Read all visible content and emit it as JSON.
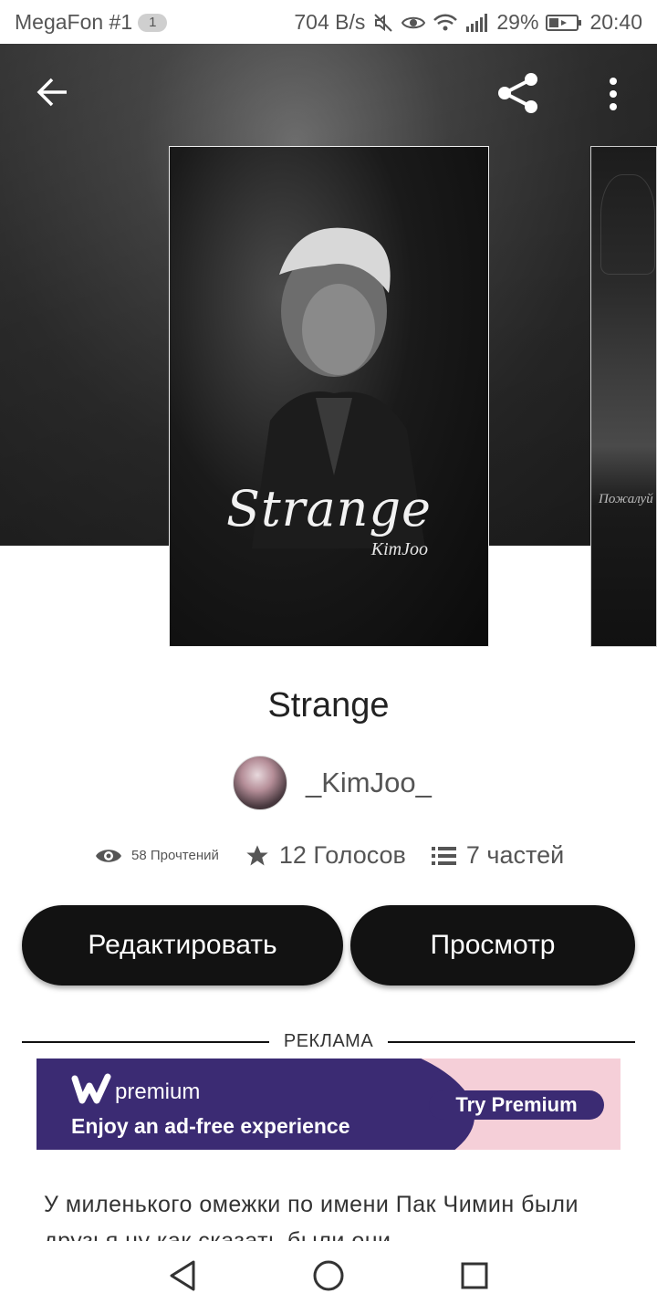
{
  "status_bar": {
    "carrier": "MegaFon #1",
    "notification_count": "1",
    "speed": "704 B/s",
    "battery": "29%",
    "time": "20:40"
  },
  "header": {
    "back_icon": "arrow-left-icon",
    "share_icon": "share-icon",
    "more_icon": "more-vertical-icon"
  },
  "cover": {
    "title": "Strange",
    "author": "KimJoo",
    "next_cover_text": "Пожалуй"
  },
  "story": {
    "title": "Strange",
    "author": "_KimJoo_",
    "reads": "58 Прочтений",
    "votes": "12 Голосов",
    "parts": "7 частей"
  },
  "buttons": {
    "edit": "Редактировать",
    "view": "Просмотр"
  },
  "ad": {
    "label": "РЕКЛАМА",
    "brand": "premium",
    "tagline": "Enjoy an ad-free experience",
    "cta": "Try Premium"
  },
  "description": "У миленького омежки по имени Пак Чимин были друзья ну как сказать были они",
  "colors": {
    "button_bg": "#121212",
    "ad_purple": "#3b2b73",
    "ad_pink": "#f5cfd8"
  }
}
